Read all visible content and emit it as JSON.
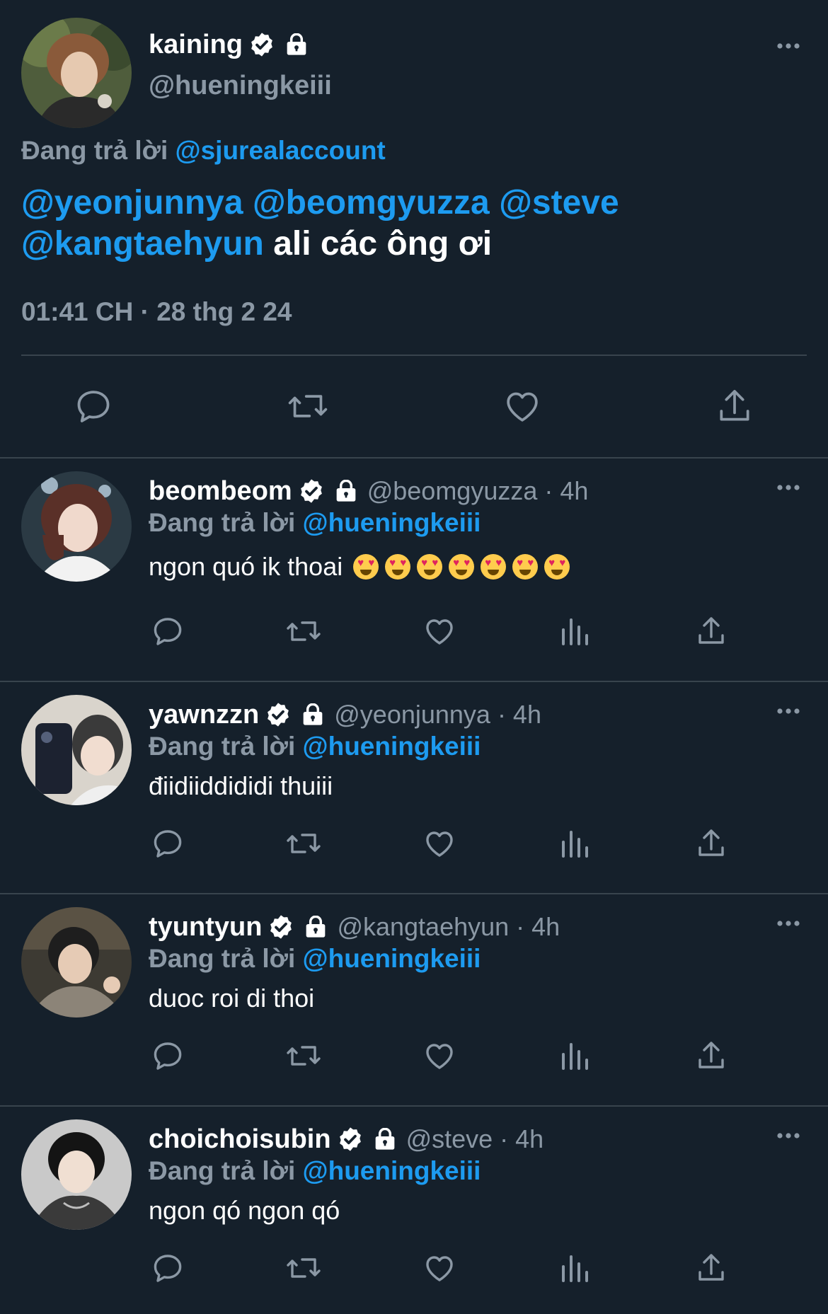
{
  "main_tweet": {
    "display_name": "kaining",
    "handle": "@hueningkeiii",
    "replying_prefix": "Đang trả lời ",
    "replying_to": "@sjurealaccount",
    "mentions": [
      "@yeonjunnya",
      "@beomgyuzza",
      "@steve",
      "@kangtaehyun"
    ],
    "text": "ali các ông ơi",
    "timestamp": "01:41 CH · 28 thg 2 24"
  },
  "replies": [
    {
      "display_name": "beombeom",
      "meta": "@beomgyuzza · 4h",
      "replying_prefix": "Đang trả lời ",
      "replying_to": "@hueningkeiii",
      "text": "ngon quó ik thoai",
      "emoji_name": "smiling-face-with-heart-eyes",
      "emoji_count": 7
    },
    {
      "display_name": "yawnzzn",
      "meta": "@yeonjunnya · 4h",
      "replying_prefix": "Đang trả lời ",
      "replying_to": "@hueningkeiii",
      "text": "điidiiddididi thuiii"
    },
    {
      "display_name": "tyuntyun",
      "meta": "@kangtaehyun · 4h",
      "replying_prefix": "Đang trả lời ",
      "replying_to": "@hueningkeiii",
      "text": "duoc roi di thoi"
    },
    {
      "display_name": "choichoisubin",
      "meta": "@steve · 4h",
      "replying_prefix": "Đang trả lời ",
      "replying_to": "@hueningkeiii",
      "text": "ngon qó ngon qó"
    }
  ],
  "icons": {
    "reply": "reply-icon",
    "retweet": "retweet-icon",
    "like": "heart-icon",
    "views": "views-icon",
    "share": "share-icon",
    "verified": "verified-badge-icon",
    "protected": "lock-icon",
    "more": "more-icon"
  },
  "colors": {
    "background": "#15202b",
    "accent": "#1d9bf0",
    "secondary_text": "#8b98a5",
    "divider": "#38444d"
  }
}
